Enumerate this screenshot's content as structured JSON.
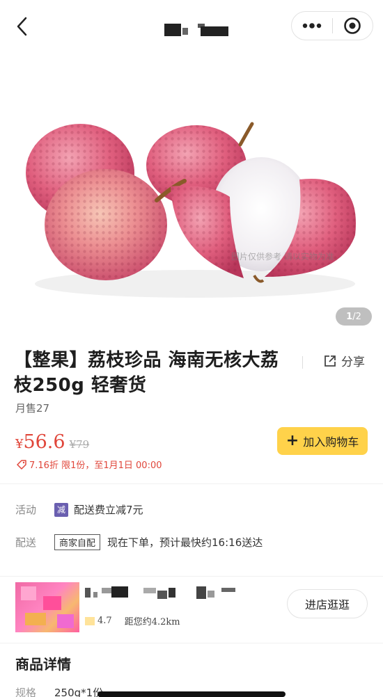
{
  "nav": {
    "title_obscured": true,
    "back_icon": "chevron-left-icon",
    "more_icon": "more-dots-icon",
    "target_icon": "record-target-icon"
  },
  "gallery": {
    "watermark": "图片仅供参考 请以实物为准",
    "current": "1",
    "total": "/2"
  },
  "product": {
    "title": "【整果】荔枝珍品 海南无核大荔枝250g 轻奢货",
    "share_label": "分享",
    "monthly_sales": "月售27",
    "price_symbol": "¥",
    "price": "56.6",
    "original_price": "¥79",
    "promo": "7.16折 限1份，至1月1日 00:00",
    "add_to_cart": "加入购物车"
  },
  "activity": {
    "label": "活动",
    "tag": "减",
    "text": "配送费立减7元"
  },
  "delivery": {
    "label": "配送",
    "tag": "商家自配",
    "text": "现在下单，预计最快约16:16送达"
  },
  "store": {
    "rating": "4.7",
    "distance": "距您约4.2km",
    "enter_button": "进店逛逛"
  },
  "details": {
    "title": "商品详情",
    "spec_label": "规格",
    "spec_value": "250g*1份"
  },
  "colors": {
    "price": "#e0463a",
    "cart_button": "#ffd24a",
    "activity_tag": "#6a5fb0"
  }
}
